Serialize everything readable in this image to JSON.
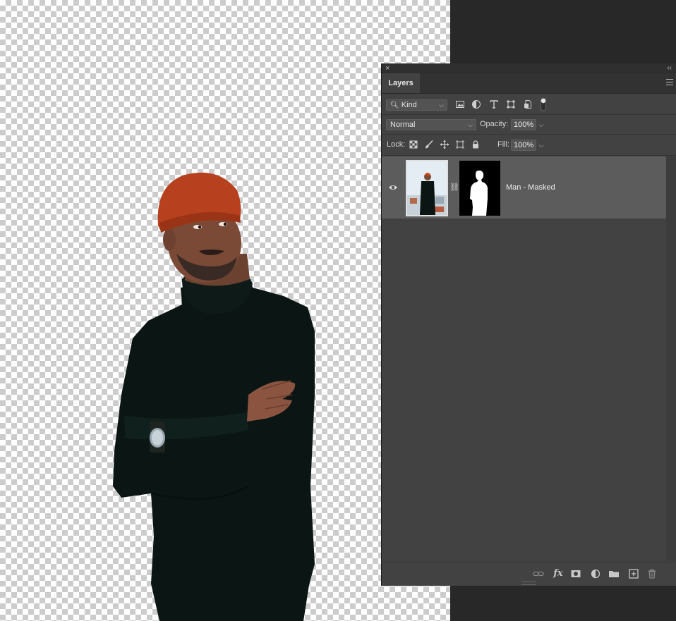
{
  "panel": {
    "close_glyph": "×",
    "collapse_glyph": "‹‹",
    "tab_label": "Layers",
    "filter": {
      "kind_label": "Kind",
      "icons": [
        "image-filter-icon",
        "adjustment-filter-icon",
        "type-filter-icon",
        "shape-filter-icon",
        "smart-object-filter-icon",
        "filter-toggle-icon"
      ]
    },
    "blend": {
      "mode": "Normal",
      "opacity_label": "Opacity:",
      "opacity_value": "100%"
    },
    "lock": {
      "label": "Lock:",
      "fill_label": "Fill:",
      "fill_value": "100%"
    },
    "layers": [
      {
        "name": "Man - Masked",
        "visible": true,
        "selected": true
      }
    ],
    "footer_icons": [
      "link-layers-icon",
      "fx-icon",
      "add-mask-icon",
      "new-adjustment-icon",
      "new-group-icon",
      "new-layer-icon",
      "delete-layer-icon"
    ],
    "fx_label": "fx"
  },
  "colors": {
    "panel_bg": "#424242",
    "selected_layer": "#5c5c5c",
    "app_bg": "#282828",
    "hat": "#b7401e",
    "sweater": "#0b1614"
  }
}
